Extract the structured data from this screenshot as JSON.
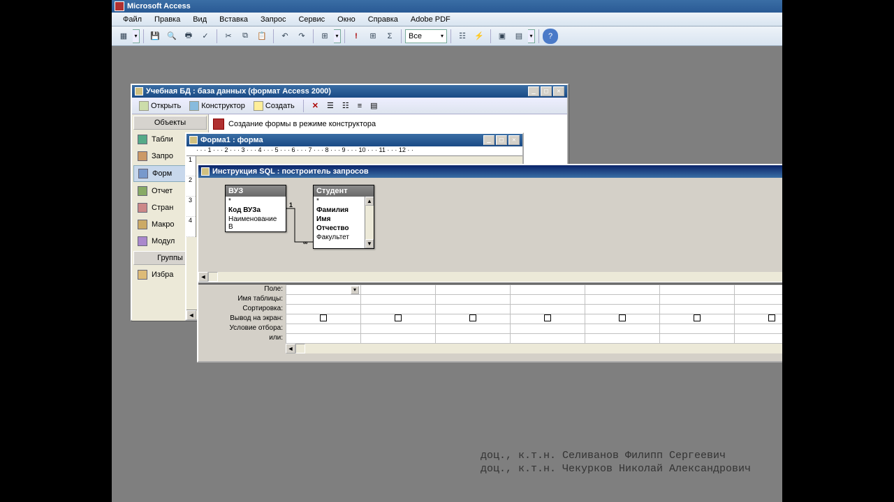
{
  "app": {
    "title": "Microsoft Access"
  },
  "menu": [
    "Файл",
    "Правка",
    "Вид",
    "Вставка",
    "Запрос",
    "Сервис",
    "Окно",
    "Справка",
    "Adobe PDF"
  ],
  "toolbar_combo": "Все",
  "dbwin": {
    "title": "Учебная БД : база данных (формат Access 2000)",
    "buttons": {
      "open": "Открыть",
      "design": "Конструктор",
      "create": "Создать"
    },
    "objects_header": "Объекты",
    "groups_header": "Группы",
    "items": [
      "Табли",
      "Запро",
      "Форм",
      "Отчет",
      "Стран",
      "Макро",
      "Модул"
    ],
    "fav": "Избра",
    "main_item": "Создание формы в режиме конструктора"
  },
  "formwin": {
    "title": "Форма1 : форма"
  },
  "sqlwin": {
    "title": "Инструкция SQL : построитель запросов",
    "table1": {
      "name": "ВУЗ",
      "fields": [
        "*",
        "Код ВУЗа",
        "Наименование В"
      ]
    },
    "table2": {
      "name": "Студент",
      "fields": [
        "*",
        "Фамилия",
        "Имя",
        "Отчество",
        "Факультет"
      ]
    },
    "rel": {
      "left": "1",
      "right": "∞"
    },
    "grid_labels": [
      "Поле:",
      "Имя таблицы:",
      "Сортировка:",
      "Вывод на экран:",
      "Условие отбора:",
      "или:"
    ]
  },
  "footer": {
    "line1": "доц., к.т.н. Селиванов Филипп Сергеевич",
    "line2": "доц., к.т.н. Чекурков Николай Александрович"
  }
}
